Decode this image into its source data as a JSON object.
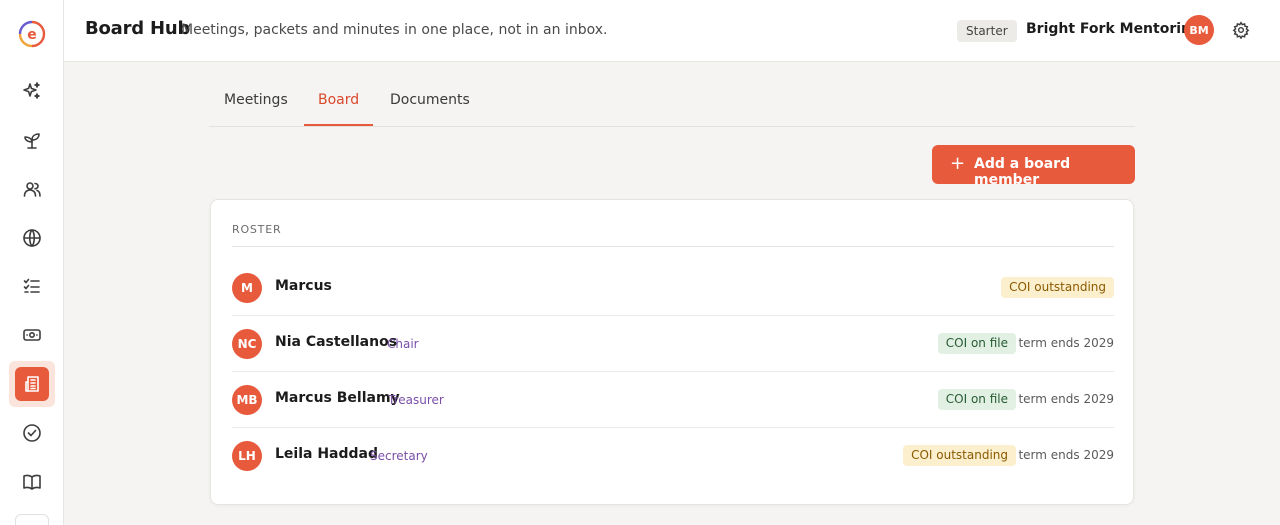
{
  "app": {
    "logo_letter": "e"
  },
  "header": {
    "title": "Board Hub",
    "subtitle": "Meetings, packets and minutes in one place, not in an inbox.",
    "plan": "Starter",
    "org_name": "Bright Fork Mentoring",
    "user_initials": "BM"
  },
  "sidebar": {
    "items": [
      {
        "icon": "sparkle-icon"
      },
      {
        "icon": "sprout-icon"
      },
      {
        "icon": "users-icon"
      },
      {
        "icon": "globe-icon"
      },
      {
        "icon": "checklist-icon"
      },
      {
        "icon": "money-icon"
      },
      {
        "icon": "board-icon",
        "active": true
      },
      {
        "icon": "check-circle-icon"
      },
      {
        "icon": "book-icon"
      }
    ]
  },
  "tabs": [
    {
      "label": "Meetings"
    },
    {
      "label": "Board",
      "active": true
    },
    {
      "label": "Documents"
    }
  ],
  "actions": {
    "add_member": "Add a board member",
    "add_icon": "+"
  },
  "roster": {
    "heading": "ROSTER",
    "members": [
      {
        "initials": "M",
        "name": "Marcus",
        "role": "",
        "coi": "COI outstanding",
        "coi_status": "outstanding",
        "term": ""
      },
      {
        "initials": "NC",
        "name": "Nia Castellanos",
        "role": "Chair",
        "coi": "COI on file",
        "coi_status": "on-file",
        "term": "term ends 2029"
      },
      {
        "initials": "MB",
        "name": "Marcus Bellamy",
        "role": "Treasurer",
        "coi": "COI on file",
        "coi_status": "on-file",
        "term": "term ends 2029"
      },
      {
        "initials": "LH",
        "name": "Leila Haddad",
        "role": "Secretary",
        "coi": "COI outstanding",
        "coi_status": "outstanding",
        "term": "term ends 2029"
      }
    ]
  },
  "colors": {
    "accent": "#e85a3c",
    "role_text": "#7b4fa8",
    "coi_outstanding_bg": "#fbefcd",
    "coi_on_file_bg": "#e2f0e4"
  }
}
